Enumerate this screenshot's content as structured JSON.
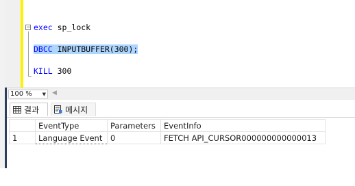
{
  "editor": {
    "lines": [
      {
        "keyword": "exec",
        "rest": " sp_lock",
        "selected": false
      },
      {
        "keyword": "DBCC",
        "rest": " INPUTBUFFER(300);",
        "selected": true
      },
      {
        "keyword": "KILL",
        "rest": " 300",
        "selected": false
      }
    ],
    "fold_symbol": "−"
  },
  "zoom": {
    "value": "100 %"
  },
  "tabs": {
    "results_label": "결과",
    "messages_label": "메시지"
  },
  "grid": {
    "columns": [
      "EventType",
      "Parameters",
      "EventInfo"
    ],
    "rows": [
      {
        "num": "1",
        "cells": [
          "Language Event",
          "0",
          "FETCH API_CURSOR000000000000013"
        ]
      }
    ]
  },
  "colors": {
    "keyword": "#0000ff",
    "selection": "#add6ff",
    "change_bar": "#fff200"
  }
}
